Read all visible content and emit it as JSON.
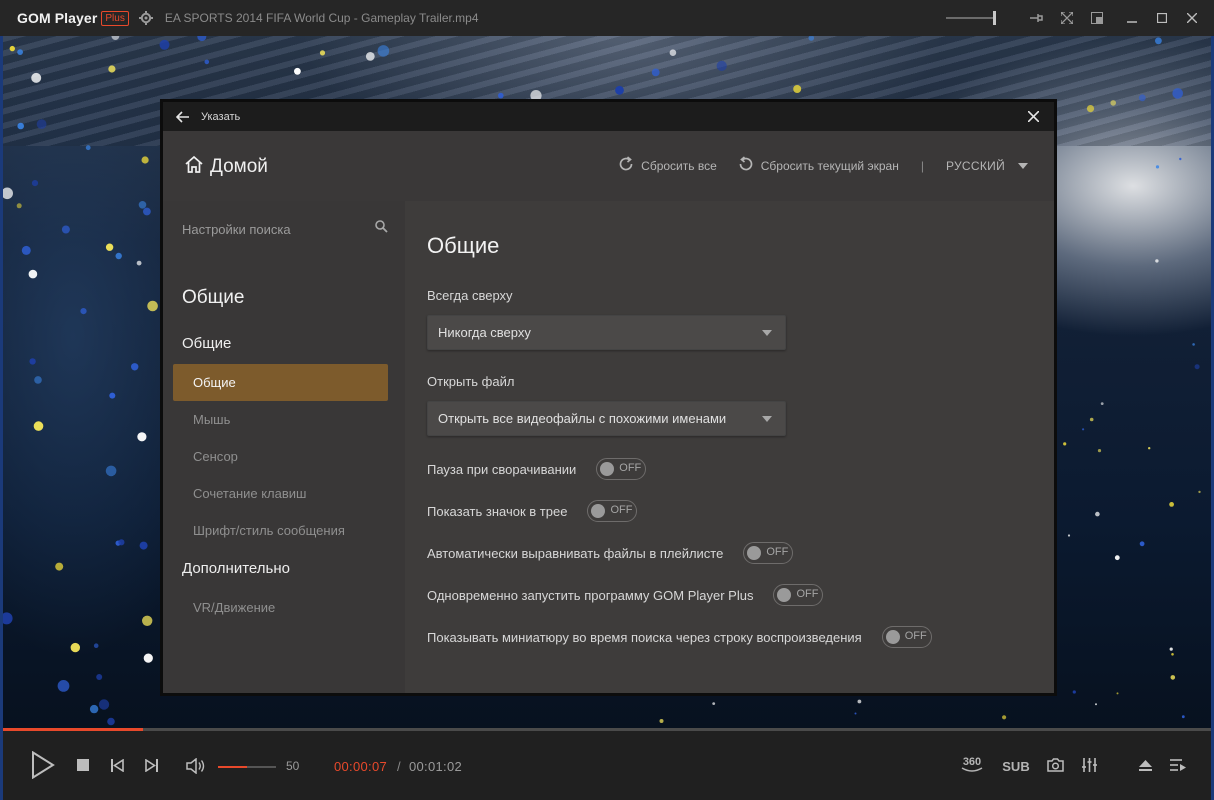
{
  "app": {
    "name": "GOM Player",
    "badge": "Plus",
    "file_title": "EA SPORTS 2014 FIFA World Cup - Gameplay Trailer.mp4"
  },
  "dialog": {
    "title": "Указать",
    "home_label": "Домой",
    "reset_all": "Сбросить все",
    "reset_current": "Сбросить текущий экран",
    "separator": "|",
    "language": "РУССКИЙ"
  },
  "sidebar": {
    "search_placeholder": "Настройки поиска",
    "section_title": "Общие",
    "group_general": "Общие",
    "items": [
      {
        "label": "Общие",
        "active": true
      },
      {
        "label": "Мышь"
      },
      {
        "label": "Сенсор"
      },
      {
        "label": "Сочетание клавиш"
      },
      {
        "label": "Шрифт/стиль сообщения"
      }
    ],
    "group_extra": "Дополнительно",
    "extra_items": [
      {
        "label": "VR/Движение"
      }
    ]
  },
  "main": {
    "title": "Общие",
    "always_on_top_label": "Всегда сверху",
    "always_on_top_value": "Никогда сверху",
    "open_file_label": "Открыть файл",
    "open_file_value": "Открыть все видеофайлы с похожими именами",
    "toggles": [
      {
        "label": "Пауза при сворачивании",
        "state": "OFF"
      },
      {
        "label": "Показать значок в трее",
        "state": "OFF"
      },
      {
        "label": "Автоматически выравнивать файлы в плейлисте",
        "state": "OFF"
      },
      {
        "label": "Одновременно запустить программу GOM Player Plus",
        "state": "OFF"
      },
      {
        "label": "Показывать миниатюру во время поиска через строку воспроизведения",
        "state": "OFF"
      }
    ]
  },
  "player": {
    "progress": 0.116,
    "volume": 50,
    "volume_label": "50",
    "time_current": "00:00:07",
    "time_separator": "/",
    "time_total": "00:01:02",
    "btn_360": "360",
    "btn_sub": "SUB"
  },
  "colors": {
    "accent": "#e8492b",
    "active_nav": "#7d5b2c"
  }
}
